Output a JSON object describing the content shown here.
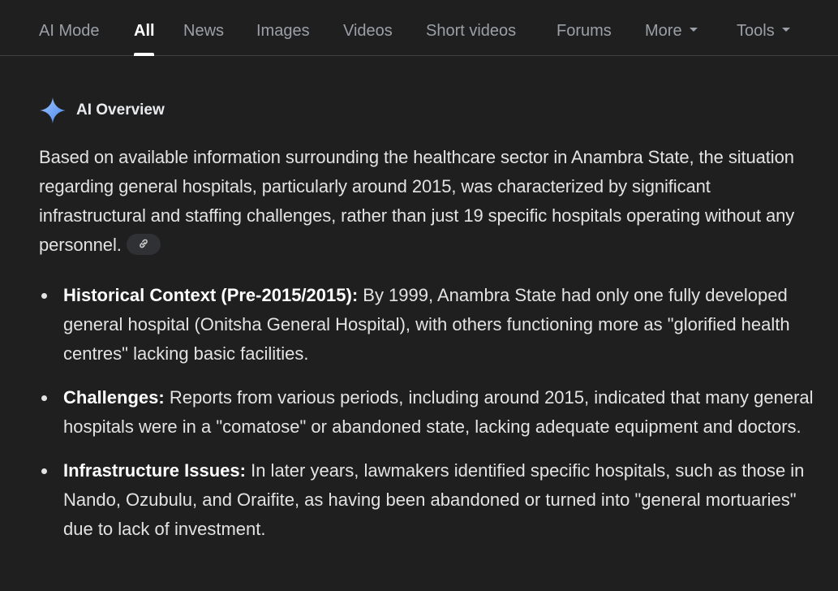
{
  "tabs": [
    {
      "label": "AI Mode",
      "active": false
    },
    {
      "label": "All",
      "active": true
    },
    {
      "label": "News",
      "active": false
    },
    {
      "label": "Images",
      "active": false
    },
    {
      "label": "Videos",
      "active": false
    },
    {
      "label": "Short videos",
      "active": false
    },
    {
      "label": "Forums",
      "active": false
    },
    {
      "label": "More",
      "active": false,
      "dropdown": true
    },
    {
      "label": "Tools",
      "active": false,
      "dropdown": true
    }
  ],
  "ai_overview": {
    "icon": "sparkle-icon",
    "title": "AI Overview",
    "intro": "Based on available information surrounding the healthcare sector in Anambra State, the situation regarding general hospitals, particularly around 2015, was characterized by significant infrastructural and staffing challenges, rather than just 19 specific hospitals operating without any personnel.",
    "link_icon": "link-icon",
    "bullets": [
      {
        "label": "Historical Context (Pre-2015/2015):",
        "text": "By 1999, Anambra State had only one fully developed general hospital (Onitsha General Hospital), with others functioning more as \"glorified health centres\" lacking basic facilities."
      },
      {
        "label": "Challenges:",
        "text": "Reports from various periods, including around 2015, indicated that many general hospitals were in a \"comatose\" or abandoned state, lacking adequate equipment and doctors."
      },
      {
        "label": "Infrastructure Issues:",
        "text": "In later years, lawmakers identified specific hospitals, such as those in Nando, Ozubulu, and Oraifite, as having been abandoned or turned into \"general mortuaries\" due to lack of investment."
      }
    ]
  },
  "colors": {
    "background": "#1f1f1f",
    "text": "#e3e3e3",
    "tab_inactive": "#9aa0a6",
    "accent_sparkle": "#8ab4f8"
  }
}
